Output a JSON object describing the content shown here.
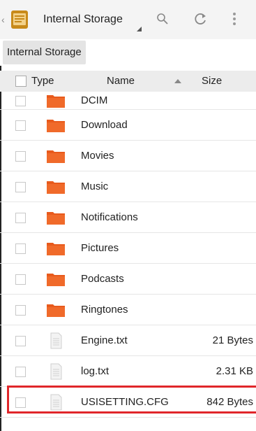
{
  "toolbar": {
    "title": "Internal Storage",
    "icons": {
      "app": "file-manager-icon",
      "search": "search-icon",
      "refresh": "refresh-icon",
      "more": "overflow-menu-icon"
    }
  },
  "breadcrumb": {
    "current": "Internal Storage"
  },
  "columns": {
    "type": "Type",
    "name": "Name",
    "size": "Size"
  },
  "files": [
    {
      "kind": "folder",
      "name": "DCIM",
      "size": ""
    },
    {
      "kind": "folder",
      "name": "Download",
      "size": ""
    },
    {
      "kind": "folder",
      "name": "Movies",
      "size": ""
    },
    {
      "kind": "folder",
      "name": "Music",
      "size": ""
    },
    {
      "kind": "folder",
      "name": "Notifications",
      "size": ""
    },
    {
      "kind": "folder",
      "name": "Pictures",
      "size": ""
    },
    {
      "kind": "folder",
      "name": "Podcasts",
      "size": ""
    },
    {
      "kind": "folder",
      "name": "Ringtones",
      "size": ""
    },
    {
      "kind": "file",
      "name": "Engine.txt",
      "size": "21 Bytes"
    },
    {
      "kind": "file",
      "name": "log.txt",
      "size": "2.31 KB"
    },
    {
      "kind": "file",
      "name": "USISETTING.CFG",
      "size": "842 Bytes",
      "highlighted": true
    }
  ],
  "colors": {
    "folder": "#f06a2a",
    "highlight": "#e0262a",
    "header": "#ececec"
  }
}
